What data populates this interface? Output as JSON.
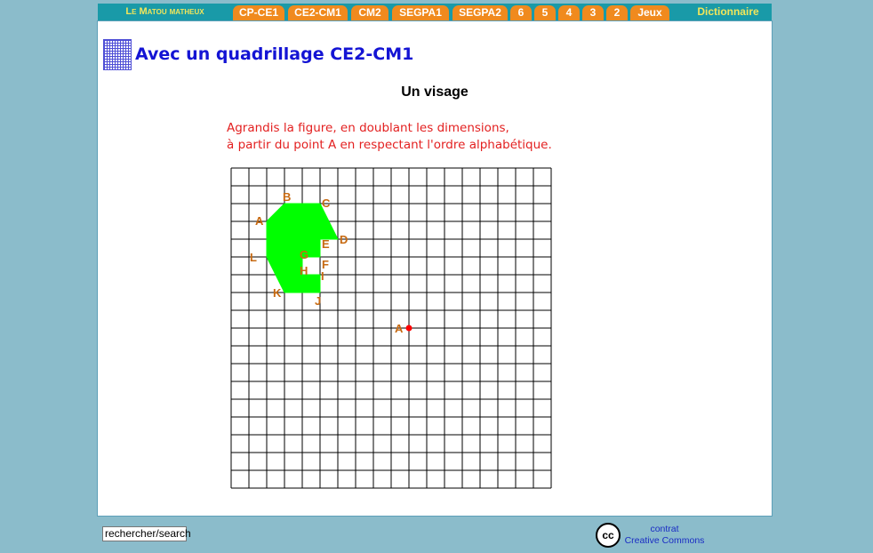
{
  "nav": {
    "brand": "Le Matou matheux",
    "tabs": [
      "CP-CE1",
      "CE2-CM1",
      "CM2",
      "SEGPA1",
      "SEGPA2",
      "6",
      "5",
      "4",
      "3",
      "2",
      "Jeux"
    ],
    "dictionary": "Dictionnaire"
  },
  "page": {
    "title": "Avec un quadrillage CE2-CM1",
    "subtitle": "Un visage",
    "instruction_line1": "Agrandis la figure, en doublant les dimensions,",
    "instruction_line2": "à partir du point A en respectant l'ordre alphabétique."
  },
  "exercise": {
    "grid_columns": 18,
    "grid_rows": 18,
    "shape_color": "#00ff00",
    "label_color": "#c76a12",
    "start_point_color": "#ff0000",
    "shape_vertices": [
      {
        "label": "A",
        "col": 2,
        "row": 3
      },
      {
        "label": "B",
        "col": 3,
        "row": 2
      },
      {
        "label": "C",
        "col": 5,
        "row": 2
      },
      {
        "label": "D",
        "col": 6,
        "row": 4
      },
      {
        "label": "E",
        "col": 5,
        "row": 4
      },
      {
        "label": "F",
        "col": 5,
        "row": 5
      },
      {
        "label": "G",
        "col": 4,
        "row": 5
      },
      {
        "label": "H",
        "col": 4,
        "row": 6
      },
      {
        "label": "I",
        "col": 5,
        "row": 6
      },
      {
        "label": "J",
        "col": 5,
        "row": 7
      },
      {
        "label": "K",
        "col": 3,
        "row": 7
      },
      {
        "label": "L",
        "col": 2,
        "row": 5
      }
    ],
    "start_point": {
      "label": "A",
      "col": 10,
      "row": 9
    }
  },
  "footer": {
    "search_value": "rechercher/search",
    "cc_icon_text": "cc",
    "cc_line1": "contrat",
    "cc_line2": "Creative Commons"
  }
}
